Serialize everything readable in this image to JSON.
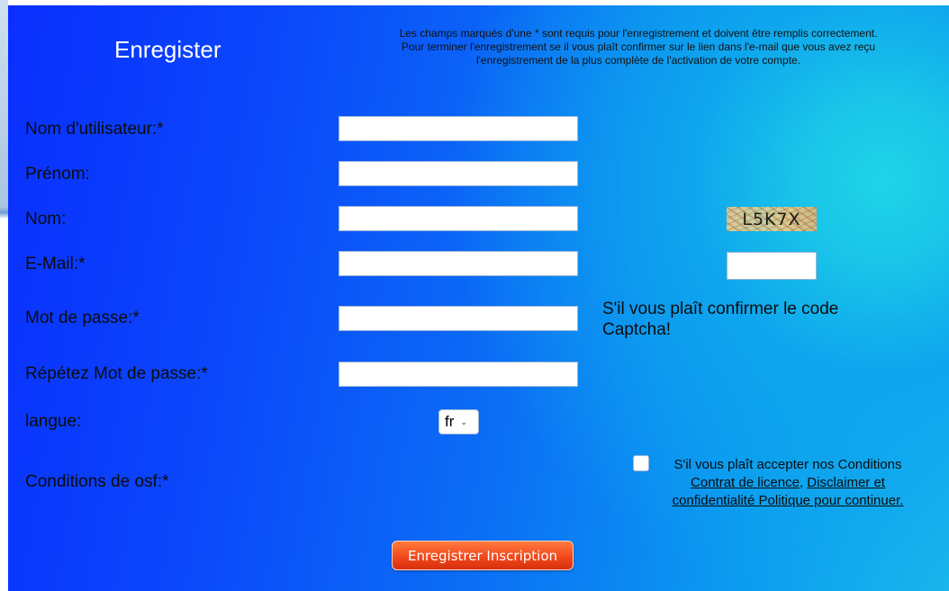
{
  "header": {
    "title": "Enregister",
    "notice_line1": "Les champs marqués d'une * sont requis pour l'enregistrement et doivent être remplis correctement.",
    "notice_line2": "Pour terminer l'enregistrement se il vous plaît confirmer sur le lien dans l'e-mail que vous avez reçu",
    "notice_line3": "l'enregistrement de la plus complète de l'activation de votre compte."
  },
  "form": {
    "username_label": "Nom d'utilisateur:*",
    "firstname_label": "Prénom:",
    "lastname_label": "Nom:",
    "email_label": "E-Mail:*",
    "password_label": "Mot de passe:*",
    "password_repeat_label": "Répétez Mot de passe:*",
    "language_label": "langue:",
    "terms_label": "Conditions de osf:*",
    "language_value": "fr",
    "username_value": "",
    "firstname_value": "",
    "lastname_value": "",
    "email_value": "",
    "password_value": "",
    "password_repeat_value": ""
  },
  "captcha": {
    "image_text": "L5K7X",
    "input_value": "",
    "prompt": "S'il vous plaît confirmer le code Captcha!"
  },
  "terms": {
    "text_before": "S'il vous plaît accepter nos Conditions",
    "link1": "Contrat de licence",
    "separator": ",",
    "link2": "Disclaimer et confidentialité Politique pour continuer."
  },
  "submit_label": "Enregistrer Inscription",
  "colors": {
    "panel_blue": "#0b46fb",
    "panel_cyan": "#1fd4e8",
    "button_orange": "#f0441a"
  }
}
